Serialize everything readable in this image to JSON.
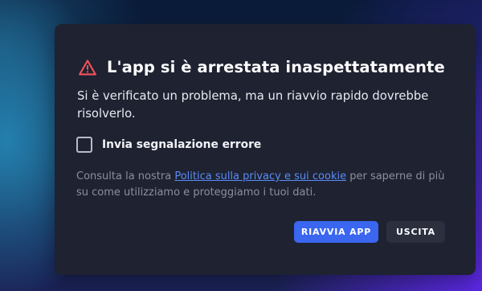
{
  "dialog": {
    "title": "L'app si è arrestata inaspettatamente",
    "icon": "warning-triangle-icon",
    "message": "Si è verificato un problema, ma un riavvio rapido dovrebbe risolverlo.",
    "checkbox": {
      "label": "Invia segnalazione errore",
      "checked": false
    },
    "privacy": {
      "prefix": "Consulta la nostra ",
      "link_text": "Politica sulla privacy e sui cookie",
      "suffix": " per saperne di più su come utilizziamo e proteggiamo i tuoi dati."
    },
    "buttons": {
      "restart_label": "RIAVVIA APP",
      "exit_label": "USCITA"
    }
  },
  "colors": {
    "dialog_background": "#1e2231",
    "primary_button": "#3a66f0",
    "secondary_button": "#2b2f3e",
    "warning_icon": "#f0505a",
    "link": "#5b8cf5"
  }
}
